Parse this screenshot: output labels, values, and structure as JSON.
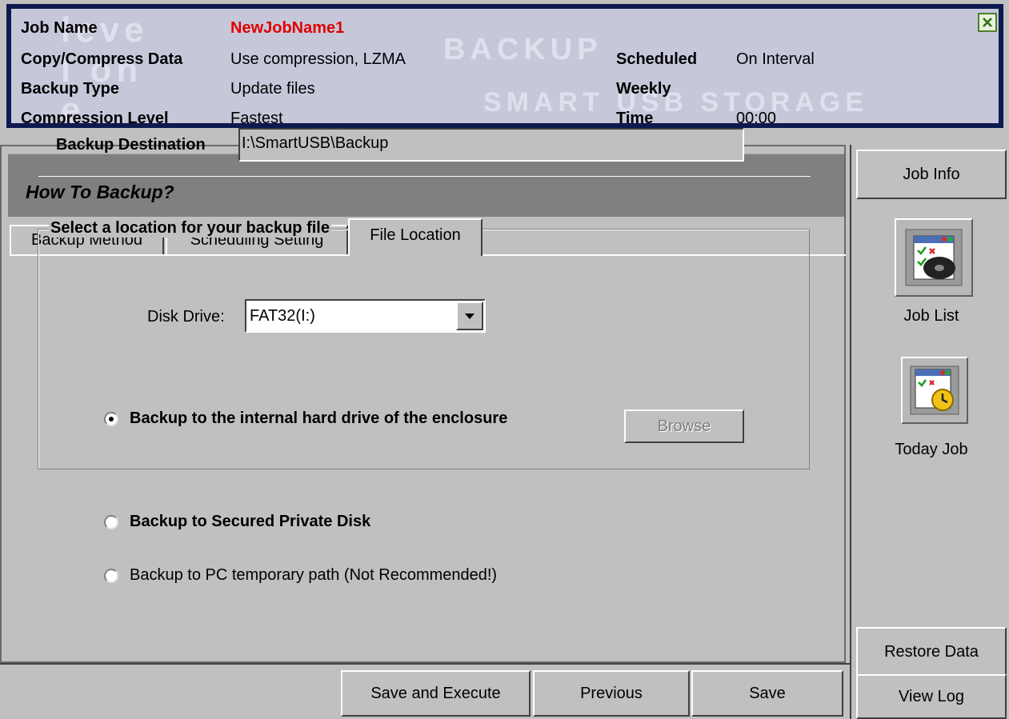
{
  "header": {
    "brand_watermark_left": "level one",
    "brand_watermark_right_1": "BACKUP",
    "brand_watermark_right_2": "SMART USB STORAGE",
    "job_name_label": "Job Name",
    "job_name_value": "NewJobName1",
    "copy_compress_label": "Copy/Compress Data",
    "copy_compress_value": "Use compression, LZMA",
    "backup_type_label": "Backup Type",
    "backup_type_value": "Update files",
    "compression_level_label": "Compression Level",
    "compression_level_value": "Fastest",
    "scheduled_label": "Scheduled",
    "scheduled_value": "On Interval",
    "weekly_label": "Weekly",
    "time_label": "Time",
    "time_value": "00:00",
    "close_icon": "close-icon"
  },
  "section": {
    "title": "How To Backup?"
  },
  "tabs": [
    {
      "label": "Backup Method"
    },
    {
      "label": "Scheduling Setting"
    },
    {
      "label": "File Location"
    }
  ],
  "file_location": {
    "destination_label": "Backup Destination",
    "destination_value": "I:\\SmartUSB\\Backup",
    "group_title": "Select a location for your backup file",
    "option_internal": "Backup to the internal hard drive of the enclosure",
    "disk_drive_label": "Disk Drive:",
    "disk_drive_value": "FAT32(I:)",
    "option_private": "Backup to Secured Private Disk",
    "option_pc": "Backup to PC temporary path (Not Recommended!)",
    "browse_label": "Browse",
    "selected_option": "internal"
  },
  "bottom_buttons": {
    "save_execute": "Save and Execute",
    "previous": "Previous",
    "save": "Save"
  },
  "sidebar": {
    "job_info": "Job Info",
    "job_list": "Job List",
    "today_job": "Today Job",
    "restore_data": "Restore Data",
    "view_log": "View Log"
  },
  "colors": {
    "header_border": "#0d1a4f",
    "header_bg": "#c6c8da",
    "job_name_color": "#e00000",
    "panel_bg": "#c0c0c0",
    "section_title_bg": "#808080"
  }
}
